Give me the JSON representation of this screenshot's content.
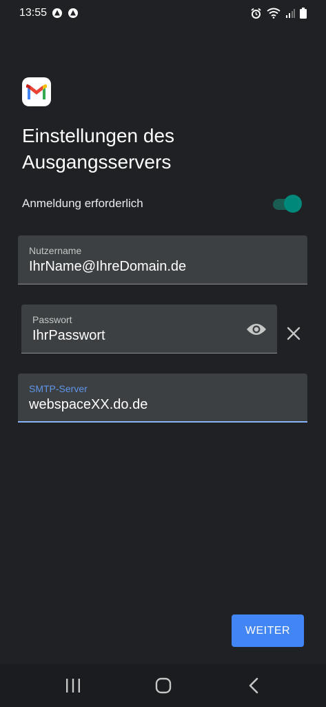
{
  "status_bar": {
    "time": "13:55",
    "icons_left": [
      "notification-icon",
      "notification-icon"
    ],
    "icons_right": [
      "alarm-icon",
      "wifi-icon",
      "signal-icon",
      "battery-icon"
    ]
  },
  "app": {
    "logo_icon": "gmail-logo-icon"
  },
  "page": {
    "title": "Einstellungen des Ausgangsservers"
  },
  "auth_toggle": {
    "label": "Anmeldung erforderlich",
    "enabled": true,
    "accent_color": "#00897b"
  },
  "fields": {
    "username": {
      "label": "Nutzername",
      "value": "IhrName@IhreDomain.de"
    },
    "password": {
      "label": "Passwort",
      "value": "IhrPasswort"
    },
    "smtp": {
      "label": "SMTP-Server",
      "value": "webspaceXX.do.de"
    }
  },
  "actions": {
    "next_label": "WEITER"
  },
  "colors": {
    "background": "#202124",
    "field_background": "#3c4043",
    "primary_button": "#4285f4",
    "focus_accent": "#8ab4f8"
  },
  "nav_bar": {
    "icons": [
      "recent-apps-icon",
      "home-icon",
      "back-icon"
    ]
  }
}
